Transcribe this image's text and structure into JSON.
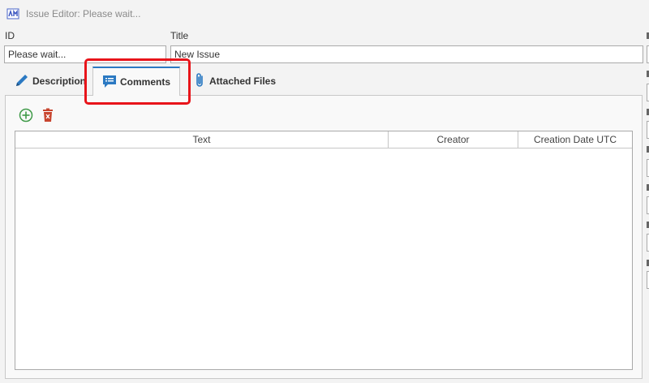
{
  "window": {
    "title": "Issue Editor: Please wait...",
    "icon": "app-logo-icon"
  },
  "fields": {
    "id_label": "ID",
    "id_value": "Please wait...",
    "title_label": "Title",
    "title_value": "New Issue"
  },
  "tabs": [
    {
      "label": "Description",
      "icon": "pencil-icon",
      "active": false
    },
    {
      "label": "Comments",
      "icon": "comment-icon",
      "active": true
    },
    {
      "label": "Attached Files",
      "icon": "paperclip-icon",
      "active": false
    }
  ],
  "toolbar": {
    "add_icon": "add-circle-icon",
    "delete_icon": "trash-icon"
  },
  "grid": {
    "columns": [
      "Text",
      "Creator",
      "Creation Date UTC"
    ],
    "rows": []
  },
  "colors": {
    "accent": "#2b79c2",
    "highlight": "#e8141a",
    "add": "#3f9a48",
    "delete": "#c8452f"
  }
}
